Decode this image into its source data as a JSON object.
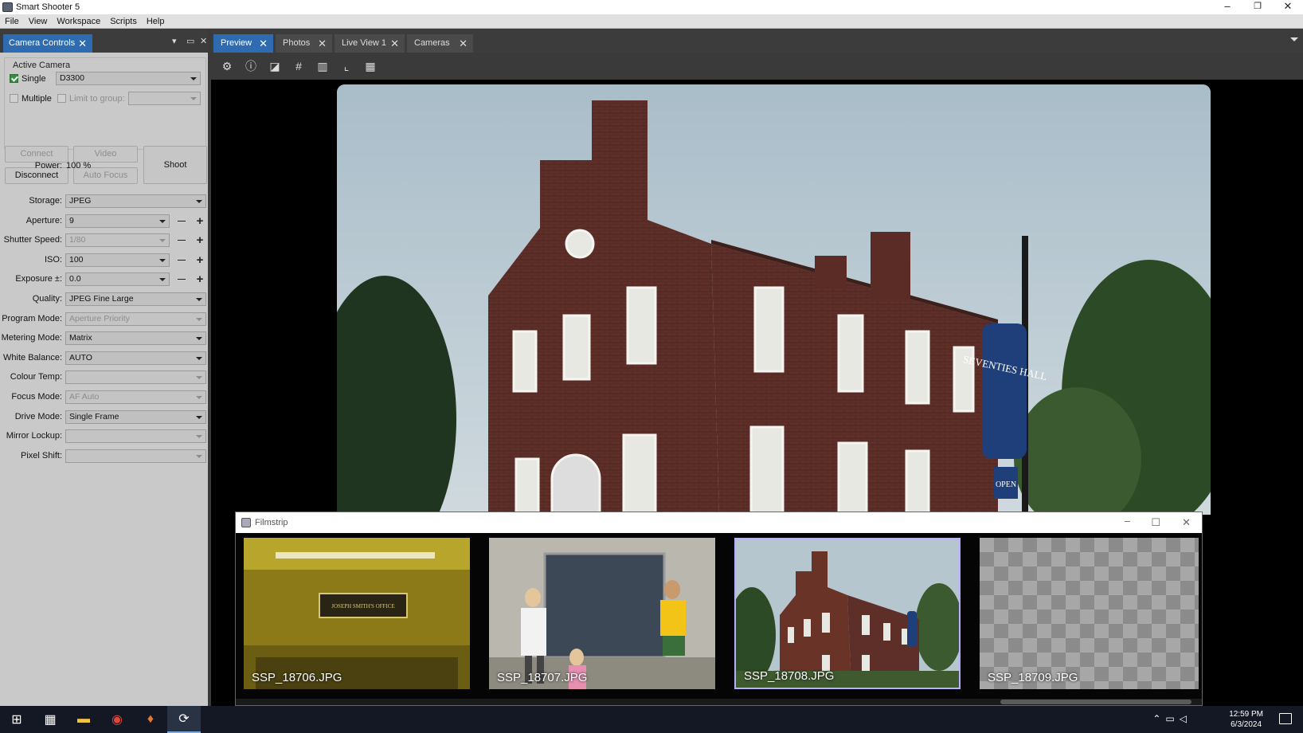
{
  "window": {
    "title": "Smart Shooter 5",
    "minimize": "–",
    "restore": "❐",
    "close": "✕"
  },
  "menu": [
    "File",
    "View",
    "Workspace",
    "Scripts",
    "Help"
  ],
  "left_panel": {
    "tab_label": "Camera Controls",
    "tab_close": "✕",
    "active_camera": {
      "group_label": "Active Camera",
      "single_label": "Single",
      "single_checked": true,
      "single_value": "D3300",
      "multiple_label": "Multiple",
      "multiple_checked": false,
      "limit_label": "Limit to group:",
      "limit_value": ""
    },
    "buttons": {
      "connect": "Connect",
      "video": "Video",
      "disconnect": "Disconnect",
      "autofocus": "Auto Focus",
      "shoot": "Shoot"
    },
    "power": {
      "label": "Power:",
      "value": "100 %"
    },
    "settings": [
      {
        "label": "Storage:",
        "value": "JPEG",
        "disabled": false,
        "stepper": false
      },
      {
        "label": "Aperture:",
        "value": "9",
        "disabled": false,
        "stepper": true
      },
      {
        "label": "Shutter Speed:",
        "value": "1/80",
        "disabled": true,
        "stepper": true
      },
      {
        "label": "ISO:",
        "value": "100",
        "disabled": false,
        "stepper": true
      },
      {
        "label": "Exposure ±:",
        "value": "0.0",
        "disabled": false,
        "stepper": true
      },
      {
        "label": "Quality:",
        "value": "JPEG Fine Large",
        "disabled": false,
        "stepper": false
      },
      {
        "label": "Program Mode:",
        "value": "Aperture Priority",
        "disabled": true,
        "stepper": false
      },
      {
        "label": "Metering Mode:",
        "value": "Matrix",
        "disabled": false,
        "stepper": false
      },
      {
        "label": "White Balance:",
        "value": "AUTO",
        "disabled": false,
        "stepper": false
      },
      {
        "label": "Colour Temp:",
        "value": "",
        "disabled": true,
        "stepper": false
      },
      {
        "label": "Focus Mode:",
        "value": "AF Auto",
        "disabled": true,
        "stepper": false
      },
      {
        "label": "Drive Mode:",
        "value": "Single Frame",
        "disabled": false,
        "stepper": false
      },
      {
        "label": "Mirror Lockup:",
        "value": "",
        "disabled": true,
        "stepper": false
      },
      {
        "label": "Pixel Shift:",
        "value": "",
        "disabled": true,
        "stepper": false
      }
    ],
    "minus": "—",
    "plus": "+"
  },
  "tabs": [
    {
      "label": "Preview",
      "active": true
    },
    {
      "label": "Photos",
      "active": false
    },
    {
      "label": "Live View 1",
      "active": false
    },
    {
      "label": "Cameras",
      "active": false
    }
  ],
  "toolbar_icons": [
    "gear-icon",
    "info-icon",
    "exposure-icon",
    "grid-icon",
    "histogram-icon",
    "focus-points-icon",
    "qr-icon"
  ],
  "preview": {
    "sign_text": "SEVENTIES HALL",
    "open_text": "OPEN"
  },
  "filmstrip": {
    "title": "Filmstrip",
    "selected_index": 2,
    "items": [
      {
        "name": "SSP_18706.JPG",
        "plaque": "JOSEPH SMITH'S OFFICE"
      },
      {
        "name": "SSP_18707.JPG"
      },
      {
        "name": "SSP_18708.JPG"
      },
      {
        "name": "SSP_18709.JPG"
      }
    ]
  },
  "taskbar": {
    "time": "12:59 PM",
    "date": "6/3/2024",
    "apps": [
      "windows-start-icon",
      "calculator-icon",
      "file-explorer-icon",
      "chrome-icon",
      "app-icon",
      "smart-shooter-icon"
    ]
  },
  "colors": {
    "accent_tab": "#2f6bb0",
    "panel_bg": "#c9c9c9",
    "selected_thumb_border": "#b7b0ff"
  }
}
